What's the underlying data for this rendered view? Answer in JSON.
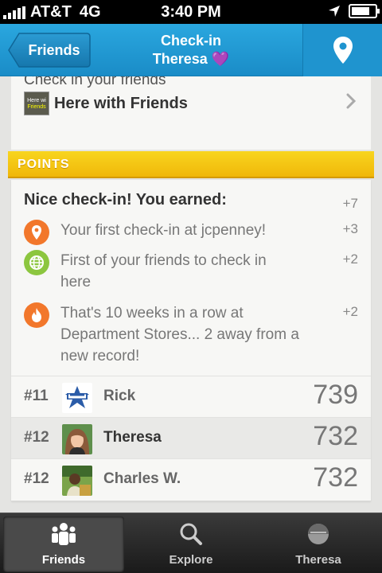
{
  "status_bar": {
    "carrier": "AT&T",
    "network": "4G",
    "time": "3:40 PM",
    "battery_level": 0.7
  },
  "nav": {
    "back_label": "Friends",
    "title_line1": "Check-in",
    "title_line2": "Theresa",
    "title_emoji": "💜",
    "location_icon": "map-pin-icon",
    "accent": "#1a8cc7"
  },
  "here_with_friends": {
    "partial_text": "Check in your friends",
    "thumb_line1": "Here wi",
    "thumb_line2": "Friends",
    "label": "Here with Friends"
  },
  "points": {
    "header": "POINTS",
    "earned_text": "Nice check-in! You earned:",
    "earned_total": "+7",
    "items": [
      {
        "icon": "pin-icon",
        "color": "#f2772b",
        "text": "Your first check-in at jcpenney!",
        "value": "+3"
      },
      {
        "icon": "globe-icon",
        "color": "#8cc63f",
        "text": "First of your friends to check in here",
        "value": "+2"
      },
      {
        "icon": "flame-icon",
        "color": "#f2772b",
        "text": "That's 10 weeks in a row at Department Stores... 2 away from a new record!",
        "value": "+2"
      }
    ]
  },
  "leaderboard": [
    {
      "rank": "#11",
      "name": "Rick",
      "score": "739",
      "selected": false
    },
    {
      "rank": "#12",
      "name": "Theresa",
      "score": "732",
      "selected": true
    },
    {
      "rank": "#12",
      "name": "Charles W.",
      "score": "732",
      "selected": false
    }
  ],
  "tabs": [
    {
      "label": "Friends",
      "icon": "friends-icon",
      "active": true
    },
    {
      "label": "Explore",
      "icon": "search-icon",
      "active": false
    },
    {
      "label": "Theresa",
      "icon": "profile-icon",
      "active": false
    }
  ]
}
